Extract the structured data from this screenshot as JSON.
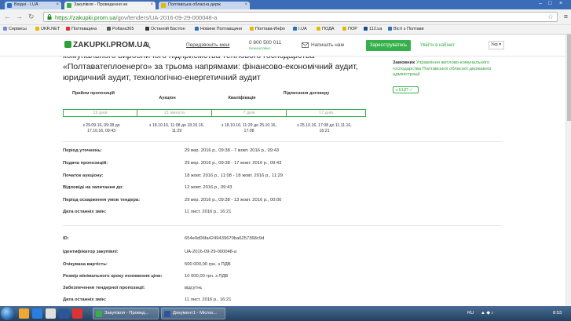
{
  "browser": {
    "tabs": [
      {
        "label": "Вхідні - I.UA",
        "active": false
      },
      {
        "label": "Закупівля - Проведення не",
        "active": true
      },
      {
        "label": "Полтавська обласна держ",
        "active": false
      }
    ],
    "url_host": "https://zakupki.prom.ua",
    "url_path": "/gov/tenders/UA-2016-09-29-000048-a",
    "bookmarks": [
      "Сервисы",
      "UKR.NET",
      "Полтавщина",
      "Poltava365",
      "Останній Бастіон",
      "Новини Полтавщини",
      "Полтава-Инфо",
      "I.UA",
      "ПОДА",
      "ПОР",
      "112.ua",
      "Вісті з Полтави"
    ]
  },
  "site": {
    "logo": "ZAKUPKI.PROM.UA",
    "feedback": "Передзвоніть мені",
    "phone": "0 800 500 011",
    "phone_note": "безкоштовно",
    "write_to_us": "Напишіть нам",
    "register": "Зареєструватись",
    "login": "Увійти в кабінет",
    "lang": "Укр"
  },
  "tender": {
    "title": "комунального виробничого підприємства теплового господарства «Полтаватеплоенерго» за трьома напрямами: фінансово-економічний аудит, юридичний аудит, технологічно-енергетичний аудит",
    "buyer_label": "Замовник",
    "buyer_name": "Управління житлово-комунального господарства Полтавської обласної державної адміністрації",
    "ecp": "з ЕЦП",
    "phases": [
      {
        "name": "Прийом пропозицій",
        "duration": "19 днів",
        "dates": "з 29.09.16, 09:38 до 17.10.16, 09:43"
      },
      {
        "name": "Аукціон",
        "duration": "21 минута",
        "dates": "з 18.10.16, 11:08 до 18.10.16, 11:29"
      },
      {
        "name": "Кваліфікація",
        "duration": "7 днів",
        "dates": "з 18.10.16, 11:29 до 25.10.16, 17:08"
      },
      {
        "name": "Підписання договору",
        "duration": "17 днів",
        "dates": "з 25.10.16, 17:08 до 11.11.16, 16:21"
      }
    ],
    "periods": [
      {
        "label": "Період уточнень:",
        "value": "29 вер. 2016 р., 09:38 - 7 жовт. 2016 р., 09:43"
      },
      {
        "label": "Подача пропозицій:",
        "value": "29 вер. 2016 р., 09:38 - 17 жовт. 2016 р., 09:43"
      },
      {
        "label": "Початок аукціону:",
        "value": "18 жовт. 2016 р., 11:08 - 18 жовт. 2016 р., 11:29"
      },
      {
        "label": "Відповіді на запитання до:",
        "value": "12 жовт. 2016 р., 09:43"
      },
      {
        "label": "Період оскарження умов тендера:",
        "value": "29 вер. 2016 р., 09:38 - 13 жовт. 2016 р., 00:00"
      },
      {
        "label": "Дата останніх змін:",
        "value": "11 лист. 2016 р., 16:21"
      }
    ],
    "details": [
      {
        "label": "ID:",
        "value": "654e0d06fa4249439670ba6257368c9d"
      },
      {
        "label": "Ідентифікатор закупівлі:",
        "value": "UA-2016-09-29-000048-a"
      },
      {
        "label": "Очікувана вартість:",
        "value": "500 000,00 грн. з ПДВ"
      },
      {
        "label": "Розмір мінімального кроку пониження ціни:",
        "value": "10 000,00 грн. з ПДВ"
      },
      {
        "label": "Забезпечення тендерної пропозиції:",
        "value": "відсутнє"
      },
      {
        "label": "Дата останніх змін:",
        "value": "11 лист. 2016 р., 16:21"
      }
    ]
  },
  "taskbar": {
    "tasks": [
      "Закупівля - Провед...",
      "Документ1 - Micros..."
    ],
    "lang": "RU",
    "time": "8:53"
  },
  "colors": {
    "brand_green": "#36b04a",
    "tab_strip": "#3b6cb7",
    "taskbar": "#2d4f75"
  }
}
